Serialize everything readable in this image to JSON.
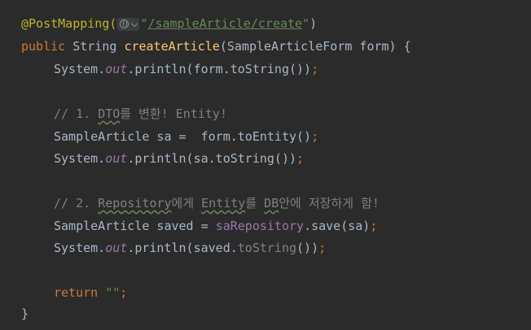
{
  "code": {
    "l1_annotation": "@PostMapping(",
    "l1_string_open": "\"",
    "l1_path": "/sampleArticle/create",
    "l1_string_close": "\"",
    "l1_close": ")",
    "l2_public": "public ",
    "l2_type": "String ",
    "l2_method": "createArticle",
    "l2_params": "(SampleArticleForm form) {",
    "l3_system": "System.",
    "l3_out": "out",
    "l3_call": ".println(form.toString())",
    "l3_semi": ";",
    "l5_comment_a": "// 1. ",
    "l5_comment_dto": "DTO",
    "l5_comment_b": "를 변환! Entity!",
    "l6_code": "SampleArticle sa =  form.toEntity()",
    "l6_semi": ";",
    "l7_system": "System.",
    "l7_out": "out",
    "l7_call": ".println(sa.toString())",
    "l7_semi": ";",
    "l9_comment_a": "// 2. ",
    "l9_comment_repo": "Repository",
    "l9_comment_b": "에게 ",
    "l9_comment_entity": "Entity",
    "l9_comment_c": "를 ",
    "l9_comment_db": "DB",
    "l9_comment_d": "안에 저장하게 함!",
    "l10_code": "SampleArticle saved = ",
    "l10_field": "saRepository",
    "l10_call": ".save(sa)",
    "l10_semi": ";",
    "l11_system": "System.",
    "l11_out": "out",
    "l11_call_a": ".println(saved.",
    "l11_call_b": "toString",
    "l11_call_c": "())",
    "l11_semi": ";",
    "l13_return": "return ",
    "l13_string": "\"\"",
    "l13_semi": ";",
    "l14_close": "}"
  },
  "inlay_hint": {
    "icon": "globe-icon",
    "dropdown_icon": "chevron-down-icon"
  },
  "colors": {
    "background": "#2b2b2b",
    "text": "#a9b7c6",
    "annotation": "#bbb529",
    "string": "#6a8759",
    "keyword": "#cc7832",
    "method_declaration": "#ffc66d",
    "field": "#9876aa",
    "comment": "#808080"
  }
}
